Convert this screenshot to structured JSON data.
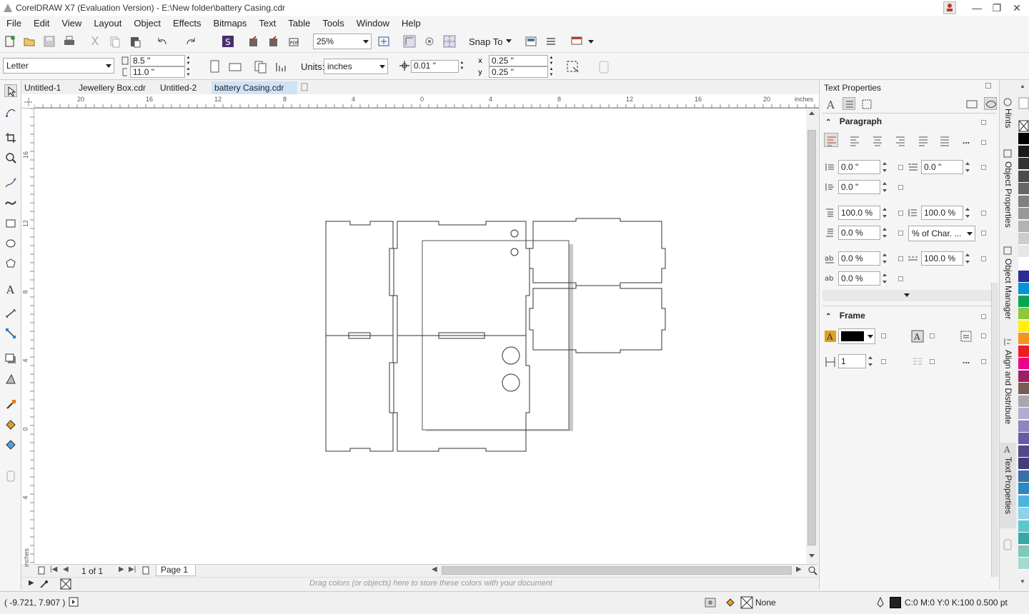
{
  "window": {
    "title": "CorelDRAW X7 (Evaluation Version) - E:\\New folder\\battery Casing.cdr"
  },
  "menu": [
    "File",
    "Edit",
    "View",
    "Layout",
    "Object",
    "Effects",
    "Bitmaps",
    "Text",
    "Table",
    "Tools",
    "Window",
    "Help"
  ],
  "toolbar": {
    "zoom_value": "25%",
    "snap_to_label": "Snap To"
  },
  "property_bar": {
    "page_size": "Letter",
    "page_width": "8.5 \"",
    "page_height": "11.0 \"",
    "units_label": "Units:",
    "units_value": "inches",
    "nudge": "0.01 \"",
    "dup_x": "0.25 \"",
    "dup_y": "0.25 \""
  },
  "document_tabs": [
    "Untitled-1",
    "Jewellery Box.cdr",
    "Untitled-2",
    "battery Casing.cdr"
  ],
  "active_tab": "battery Casing.cdr",
  "rulers": {
    "unit_label": "inches",
    "h_ticks": [
      "20",
      "16",
      "12",
      "8",
      "4",
      "0",
      "4",
      "8",
      "12",
      "16",
      "20"
    ],
    "v_ticks": [
      "16",
      "12",
      "8",
      "4",
      "0",
      "4"
    ]
  },
  "page_navigator": {
    "count": "1 of 1",
    "page_tab": "Page 1"
  },
  "palette_hint": "Drag colors (or objects) here to store these colors with your document",
  "status": {
    "coords": "( -9.721, 7.907 )",
    "fill": "None",
    "outline": "C:0 M:0 Y:0 K:100  0.500 pt"
  },
  "docker": {
    "title": "Text Properties",
    "paragraph_label": "Paragraph",
    "left_indent": "0.0 \"",
    "first_line_indent": "0.0 \"",
    "right_indent": "0.0 \"",
    "line_spacing": "100.0 %",
    "before_paragraph": "100.0 %",
    "after_paragraph": "0.0 %",
    "spacing_units": "% of Char. ...",
    "char_spacing": "0.0 %",
    "word_spacing": "100.0 %",
    "language_spacing": "0.0 %",
    "frame_label": "Frame",
    "columns": "1"
  },
  "side_tabs": [
    "Hints",
    "Object Properties",
    "Object Manager",
    "Align and Distribute",
    "Text Properties"
  ],
  "palette_colors": [
    "#000000",
    "#1a1a1a",
    "#333333",
    "#4d4d4d",
    "#666666",
    "#808080",
    "#999999",
    "#b3b3b3",
    "#cccccc",
    "#e6e6e6",
    "#ffffff",
    "#2b2b9a",
    "#0095d9",
    "#00a651",
    "#8dc63f",
    "#fff200",
    "#f7941d",
    "#ed1c24",
    "#ec008c",
    "#9e1f63",
    "#7b5c54",
    "#a7a9ac",
    "#b8a9d4",
    "#8f83c0",
    "#6a5aa6",
    "#4f4a8a",
    "#463d79",
    "#3a6fa8",
    "#2d87c4",
    "#4fb3e0",
    "#8fd0ea",
    "#5ac8c8",
    "#3aa6a6",
    "#7ec8c0",
    "#a8d8d0"
  ]
}
